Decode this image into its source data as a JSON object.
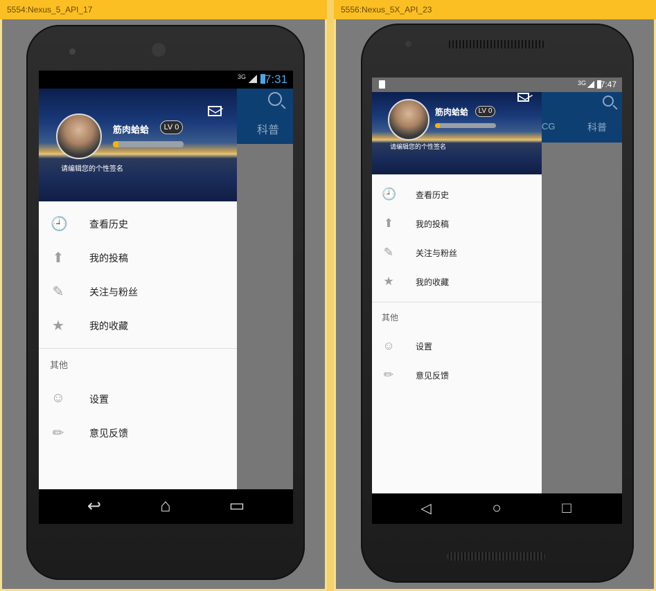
{
  "windows": [
    {
      "title": "5554:Nexus_5_API_17",
      "status_time": "7:31",
      "network": "3G",
      "tab": "科普",
      "user": {
        "name": "筋肉蛤蛤",
        "level": "LV 0",
        "signature": "请编辑您的个性签名",
        "exp_fraction": 0.05
      },
      "menu": [
        {
          "icon": "history-icon",
          "label": "查看历史"
        },
        {
          "icon": "upload-icon",
          "label": "我的投稿"
        },
        {
          "icon": "follow-icon",
          "label": "关注与粉丝"
        },
        {
          "icon": "star-icon",
          "label": "我的收藏"
        }
      ],
      "section_title": "其他",
      "other_menu": [
        {
          "icon": "android-icon",
          "label": "设置"
        },
        {
          "icon": "pencil-icon",
          "label": "意见反馈"
        }
      ]
    },
    {
      "title": "5556:Nexus_5X_API_23",
      "status_time": "7:47",
      "network": "3G",
      "tab_partial": "CG",
      "tab": "科普",
      "user": {
        "name": "筋肉蛤蛤",
        "level": "LV 0",
        "signature": "请编辑您的个性签名",
        "exp_fraction": 0.05
      },
      "menu": [
        {
          "icon": "history-icon",
          "label": "查看历史"
        },
        {
          "icon": "upload-icon",
          "label": "我的投稿"
        },
        {
          "icon": "follow-icon",
          "label": "关注与粉丝"
        },
        {
          "icon": "star-icon",
          "label": "我的收藏"
        }
      ],
      "section_title": "其他",
      "other_menu": [
        {
          "icon": "android-icon",
          "label": "设置"
        },
        {
          "icon": "pencil-icon",
          "label": "意见反馈"
        }
      ]
    }
  ],
  "colors": {
    "accent": "#fbbf24",
    "toolbar": "#0e3f72",
    "icon": "#9e9e9e"
  },
  "glyphs": {
    "history": "🕘",
    "upload": "⬆",
    "follow": "✎",
    "star": "★",
    "android": "☺",
    "pencil": "✏",
    "back": "↩",
    "home": "⌂",
    "recents": "▭",
    "nav_back": "◁",
    "nav_home": "○",
    "nav_recent": "□"
  }
}
